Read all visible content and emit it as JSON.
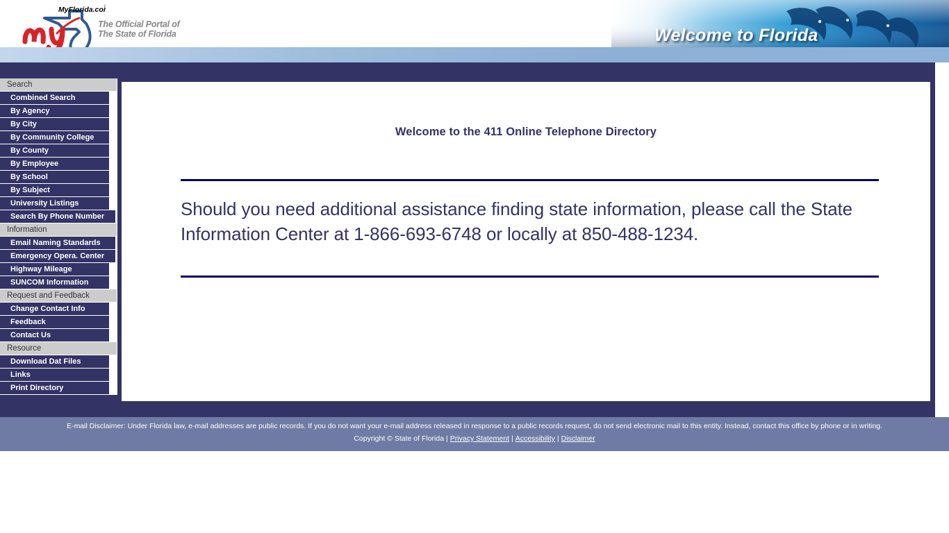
{
  "header": {
    "logo_wordmark": "my",
    "logo_domain": "MyFlorida.com",
    "logo_registered": "®",
    "tagline": "The Official Portal of\nThe State of Florida",
    "banner_text": "Welcome to Florida"
  },
  "sidebar": {
    "groups": [
      {
        "title": "Search",
        "items": [
          {
            "label": "Combined Search",
            "wide": false
          },
          {
            "label": "By Agency",
            "wide": false
          },
          {
            "label": "By City",
            "wide": false
          },
          {
            "label": "By Community College",
            "wide": false
          },
          {
            "label": "By County",
            "wide": false
          },
          {
            "label": "By Employee",
            "wide": false
          },
          {
            "label": "By School",
            "wide": false
          },
          {
            "label": "By Subject",
            "wide": false
          },
          {
            "label": "University Listings",
            "wide": false
          },
          {
            "label": "Search By Phone Number",
            "wide": true
          }
        ]
      },
      {
        "title": "Information",
        "items": [
          {
            "label": "Email Naming Standards",
            "wide": true
          },
          {
            "label": "Emergency Opera. Center",
            "wide": true
          },
          {
            "label": "Highway Mileage",
            "wide": false
          },
          {
            "label": "SUNCOM Information",
            "wide": false
          }
        ]
      },
      {
        "title": "Request and Feedback",
        "items": [
          {
            "label": "Change Contact Info",
            "wide": false
          },
          {
            "label": "Feedback",
            "wide": false
          },
          {
            "label": "Contact Us",
            "wide": false
          }
        ]
      },
      {
        "title": "Resource",
        "items": [
          {
            "label": "Download Dat Files",
            "wide": false
          },
          {
            "label": "Links",
            "wide": false
          },
          {
            "label": "Print Directory",
            "wide": false
          }
        ]
      }
    ]
  },
  "main": {
    "title": "Welcome to the 411 Online Telephone Directory",
    "body": "Should you need additional assistance finding state information, please call the State Information Center at 1-866-693-6748 or locally at 850-488-1234."
  },
  "footer": {
    "disclaimer": "E-mail Disclaimer: Under Florida law, e-mail addresses are public records. If you do not want your e-mail address released in response to a public records request, do not send electronic mail to this entity. Instead, contact this office by phone or in writing.",
    "copyright": "Copyright © State of Florida",
    "links": [
      "Privacy Statement",
      "Accessibility",
      "Disclaimer"
    ],
    "separator": "|"
  },
  "colors": {
    "navy": "#333366",
    "section_gray": "#cccccc",
    "footer_slate": "#707ba5",
    "rule": "#000066",
    "logo_red": "#d8232a",
    "logo_blue": "#2f5b94"
  }
}
